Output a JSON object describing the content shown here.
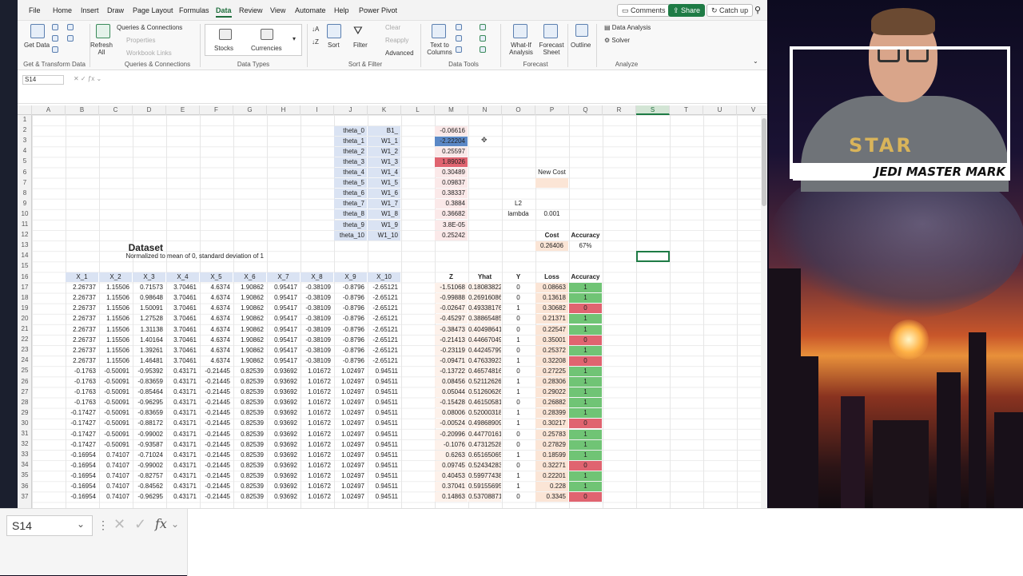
{
  "menu": {
    "items": [
      "File",
      "Home",
      "Insert",
      "Draw",
      "Page Layout",
      "Formulas",
      "Data",
      "Review",
      "View",
      "Automate",
      "Help",
      "Power Pivot"
    ],
    "active": "Data",
    "comments": "Comments",
    "share": "Share",
    "catchup": "Catch up"
  },
  "ribbon": {
    "get_data": "Get Data",
    "refresh_all": "Refresh All",
    "queries_connections": "Queries & Connections",
    "properties": "Properties",
    "workbook_links": "Workbook Links",
    "stocks": "Stocks",
    "currencies": "Currencies",
    "sort": "Sort",
    "filter": "Filter",
    "clear": "Clear",
    "reapply": "Reapply",
    "advanced": "Advanced",
    "text_to_columns": "Text to Columns",
    "what_if": "What-If Analysis",
    "forecast_sheet": "Forecast Sheet",
    "outline": "Outline",
    "data_analysis": "Data Analysis",
    "solver": "Solver",
    "groups": {
      "get_transform": "Get & Transform Data",
      "queries": "Queries & Connections",
      "data_types": "Data Types",
      "sort_filter": "Sort & Filter",
      "data_tools": "Data Tools",
      "forecast": "Forecast",
      "analyze": "Analyze"
    }
  },
  "namebox": "S14",
  "columns": [
    "A",
    "B",
    "C",
    "D",
    "E",
    "F",
    "G",
    "H",
    "I",
    "J",
    "K",
    "L",
    "M",
    "N",
    "O",
    "P",
    "Q",
    "R",
    "S",
    "T",
    "U",
    "V"
  ],
  "selected_column": "S",
  "rows": [
    "1",
    "2",
    "3",
    "4",
    "5",
    "6",
    "7",
    "8",
    "9",
    "10",
    "11",
    "12",
    "13",
    "14",
    "15",
    "16",
    "17",
    "18",
    "19",
    "20",
    "21",
    "22",
    "23",
    "24",
    "25",
    "26",
    "27",
    "28",
    "29",
    "30",
    "31",
    "32",
    "33",
    "34",
    "35",
    "36",
    "37"
  ],
  "params": [
    {
      "name": "theta_0",
      "w": "B1_",
      "v": "-0.06616"
    },
    {
      "name": "theta_1",
      "w": "W1_1",
      "v": "-2.22204"
    },
    {
      "name": "theta_2",
      "w": "W1_2",
      "v": "0.25597"
    },
    {
      "name": "theta_3",
      "w": "W1_3",
      "v": "1.89026"
    },
    {
      "name": "theta_4",
      "w": "W1_4",
      "v": "0.30489"
    },
    {
      "name": "theta_5",
      "w": "W1_5",
      "v": "0.09837"
    },
    {
      "name": "theta_6",
      "w": "W1_6",
      "v": "0.38337"
    },
    {
      "name": "theta_7",
      "w": "W1_7",
      "v": "0.3884"
    },
    {
      "name": "theta_8",
      "w": "W1_8",
      "v": "0.36682"
    },
    {
      "name": "theta_9",
      "w": "W1_9",
      "v": "3.8E-05"
    },
    {
      "name": "theta_10",
      "w": "W1_10",
      "v": "0.25242"
    }
  ],
  "side": {
    "new_cost": "New Cost",
    "l2": "L2",
    "lambda": "lambda",
    "lambda_val": "0.001",
    "cost_label": "Cost",
    "accuracy_label": "Accuracy",
    "cost": "0.26406",
    "accuracy": "67%"
  },
  "dataset_title": "Dataset",
  "dataset_subtitle": "Normalized to mean of 0, standard deviation of 1",
  "headers": [
    "X_1",
    "X_2",
    "X_3",
    "X_4",
    "X_5",
    "X_6",
    "X_7",
    "X_8",
    "X_9",
    "X_10",
    "Z",
    "Yhat",
    "Y",
    "Loss",
    "Accuracy"
  ],
  "data_rows": [
    [
      "2.26737",
      "1.15506",
      "0.71573",
      "3.70461",
      "4.6374",
      "1.90862",
      "0.95417",
      "-0.38109",
      "-0.8796",
      "-2.65121",
      "-1.51068",
      "0.18083822",
      "0",
      "0.08663",
      "1"
    ],
    [
      "2.26737",
      "1.15506",
      "0.98648",
      "3.70461",
      "4.6374",
      "1.90862",
      "0.95417",
      "-0.38109",
      "-0.8796",
      "-2.65121",
      "-0.99888",
      "0.26916086",
      "0",
      "0.13618",
      "1"
    ],
    [
      "2.26737",
      "1.15506",
      "1.50091",
      "3.70461",
      "4.6374",
      "1.90862",
      "0.95417",
      "-0.38109",
      "-0.8796",
      "-2.65121",
      "-0.02647",
      "0.49338176",
      "1",
      "0.30682",
      "0"
    ],
    [
      "2.26737",
      "1.15506",
      "1.27528",
      "3.70461",
      "4.6374",
      "1.90862",
      "0.95417",
      "-0.38109",
      "-0.8796",
      "-2.65121",
      "-0.45297",
      "0.38865485",
      "0",
      "0.21371",
      "1"
    ],
    [
      "2.26737",
      "1.15506",
      "1.31138",
      "3.70461",
      "4.6374",
      "1.90862",
      "0.95417",
      "-0.38109",
      "-0.8796",
      "-2.65121",
      "-0.38473",
      "0.40498641",
      "0",
      "0.22547",
      "1"
    ],
    [
      "2.26737",
      "1.15506",
      "1.40164",
      "3.70461",
      "4.6374",
      "1.90862",
      "0.95417",
      "-0.38109",
      "-0.8796",
      "-2.65121",
      "-0.21413",
      "0.44667049",
      "1",
      "0.35001",
      "0"
    ],
    [
      "2.26737",
      "1.15506",
      "1.39261",
      "3.70461",
      "4.6374",
      "1.90862",
      "0.95417",
      "-0.38109",
      "-0.8796",
      "-2.65121",
      "-0.23119",
      "0.44245799",
      "0",
      "0.25372",
      "1"
    ],
    [
      "2.26737",
      "1.15506",
      "1.46481",
      "3.70461",
      "4.6374",
      "1.90862",
      "0.95417",
      "-0.38109",
      "-0.8796",
      "-2.65121",
      "-0.09471",
      "0.47633923",
      "1",
      "0.32208",
      "0"
    ],
    [
      "-0.1763",
      "-0.50091",
      "-0.95392",
      "0.43171",
      "-0.21445",
      "0.82539",
      "0.93692",
      "1.01672",
      "1.02497",
      "0.94511",
      "-0.13722",
      "0.46574816",
      "0",
      "0.27225",
      "1"
    ],
    [
      "-0.1763",
      "-0.50091",
      "-0.83659",
      "0.43171",
      "-0.21445",
      "0.82539",
      "0.93692",
      "1.01672",
      "1.02497",
      "0.94511",
      "0.08456",
      "0.52112626",
      "1",
      "0.28306",
      "1"
    ],
    [
      "-0.1763",
      "-0.50091",
      "-0.85464",
      "0.43171",
      "-0.21445",
      "0.82539",
      "0.93692",
      "1.01672",
      "1.02497",
      "0.94511",
      "0.05044",
      "0.51260626",
      "1",
      "0.29022",
      "1"
    ],
    [
      "-0.1763",
      "-0.50091",
      "-0.96295",
      "0.43171",
      "-0.21445",
      "0.82539",
      "0.93692",
      "1.01672",
      "1.02497",
      "0.94511",
      "-0.15428",
      "0.46150581",
      "0",
      "0.26882",
      "1"
    ],
    [
      "-0.17427",
      "-0.50091",
      "-0.83659",
      "0.43171",
      "-0.21445",
      "0.82539",
      "0.93692",
      "1.01672",
      "1.02497",
      "0.94511",
      "0.08006",
      "0.52000318",
      "1",
      "0.28399",
      "1"
    ],
    [
      "-0.17427",
      "-0.50091",
      "-0.88172",
      "0.43171",
      "-0.21445",
      "0.82539",
      "0.93692",
      "1.01672",
      "1.02497",
      "0.94511",
      "-0.00524",
      "0.49868909",
      "1",
      "0.30217",
      "0"
    ],
    [
      "-0.17427",
      "-0.50091",
      "-0.99002",
      "0.43171",
      "-0.21445",
      "0.82539",
      "0.93692",
      "1.01672",
      "1.02497",
      "0.94511",
      "-0.20996",
      "0.44770161",
      "0",
      "0.25783",
      "1"
    ],
    [
      "-0.17427",
      "-0.50091",
      "-0.93587",
      "0.43171",
      "-0.21445",
      "0.82539",
      "0.93692",
      "1.01672",
      "1.02497",
      "0.94511",
      "-0.1076",
      "0.47312528",
      "0",
      "0.27829",
      "1"
    ],
    [
      "-0.16954",
      "0.74107",
      "-0.71024",
      "0.43171",
      "-0.21445",
      "0.82539",
      "0.93692",
      "1.01672",
      "1.02497",
      "0.94511",
      "0.6263",
      "0.65165065",
      "1",
      "0.18599",
      "1"
    ],
    [
      "-0.16954",
      "0.74107",
      "-0.99002",
      "0.43171",
      "-0.21445",
      "0.82539",
      "0.93692",
      "1.01672",
      "1.02497",
      "0.94511",
      "0.09745",
      "0.52434283",
      "0",
      "0.32271",
      "0"
    ],
    [
      "-0.16954",
      "0.74107",
      "-0.82757",
      "0.43171",
      "-0.21445",
      "0.82539",
      "0.93692",
      "1.01672",
      "1.02497",
      "0.94511",
      "0.40453",
      "0.59977438",
      "1",
      "0.22201",
      "1"
    ],
    [
      "-0.16954",
      "0.74107",
      "-0.84562",
      "0.43171",
      "-0.21445",
      "0.82539",
      "0.93692",
      "1.01672",
      "1.02497",
      "0.94511",
      "0.37041",
      "0.59155695",
      "1",
      "0.228",
      "1"
    ],
    [
      "-0.16954",
      "0.74107",
      "-0.96295",
      "0.43171",
      "-0.21445",
      "0.82539",
      "0.93692",
      "1.01672",
      "1.02497",
      "0.94511",
      "0.14863",
      "0.53708871",
      "0",
      "0.3345",
      "0"
    ]
  ],
  "webcam": {
    "banner": "JEDI MASTER MARK",
    "shirt": "STAR"
  },
  "colors": {
    "accent": "#1e7b45",
    "param_bg": "#dae3f3",
    "loss_bg": "#fbe5d6",
    "acc_good": "#70c475",
    "acc_bad": "#e06470",
    "theta1_bg": "#5b88c6",
    "theta3_bg": "#e06470"
  }
}
